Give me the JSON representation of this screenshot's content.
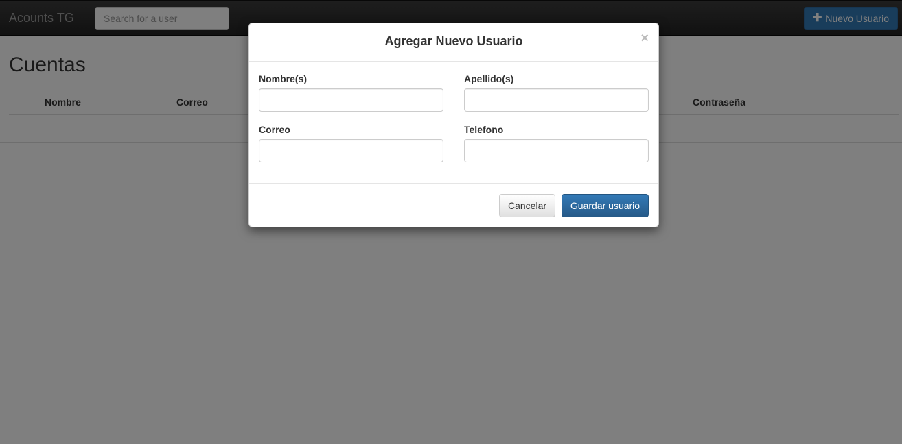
{
  "navbar": {
    "brand": "Acounts TG",
    "search_placeholder": "Search for a user",
    "new_user_label": "Nuevo Usuario"
  },
  "page": {
    "title": "Cuentas",
    "table_headers": [
      "Nombre",
      "Correo",
      "Contraseña"
    ]
  },
  "modal": {
    "title": "Agregar Nuevo Usuario",
    "close_symbol": "×",
    "fields": [
      {
        "label": "Nombre(s)",
        "value": ""
      },
      {
        "label": "Apellido(s)",
        "value": ""
      },
      {
        "label": "Correo",
        "value": ""
      },
      {
        "label": "Telefono",
        "value": ""
      }
    ],
    "cancel_label": "Cancelar",
    "save_label": "Guardar usuario"
  },
  "colors": {
    "primary": "#337ab7",
    "navbar": "#222222",
    "backdrop": "rgba(0,0,0,0.5)"
  }
}
